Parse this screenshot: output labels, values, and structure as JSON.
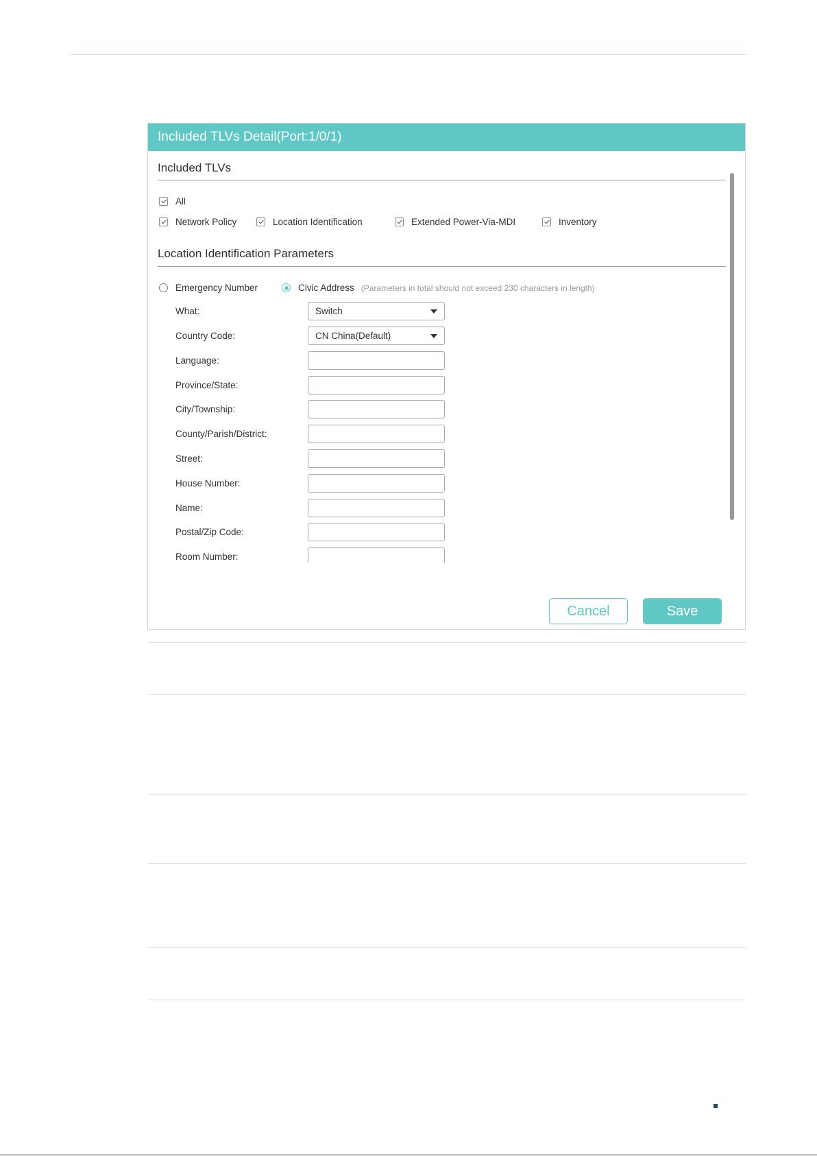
{
  "dialog": {
    "title": "Included TLVs Detail(Port:1/0/1)",
    "included_tlvs": {
      "heading": "Included TLVs",
      "all": {
        "label": "All",
        "checked": true
      },
      "options": [
        {
          "label": "Network Policy",
          "checked": true
        },
        {
          "label": "Location Identification",
          "checked": true
        },
        {
          "label": "Extended Power-Via-MDI",
          "checked": true
        },
        {
          "label": "Inventory",
          "checked": true
        }
      ]
    },
    "location": {
      "heading": "Location Identification Parameters",
      "emergency_label": "Emergency Number",
      "civic_label": "Civic Address",
      "civic_note": "(Parameters in total should not exceed 230 characters in length)",
      "selected": "Civic Address"
    },
    "fields": {
      "what": {
        "label": "What:",
        "value": "Switch"
      },
      "country_code": {
        "label": "Country Code:",
        "value": "CN China(Default)"
      },
      "language": {
        "label": "Language:",
        "value": ""
      },
      "province": {
        "label": "Province/State:",
        "value": ""
      },
      "city": {
        "label": "City/Township:",
        "value": ""
      },
      "county": {
        "label": "County/Parish/District:",
        "value": ""
      },
      "street": {
        "label": "Street:",
        "value": ""
      },
      "house_number": {
        "label": "House Number:",
        "value": ""
      },
      "name": {
        "label": "Name:",
        "value": ""
      },
      "postal": {
        "label": "Postal/Zip Code:",
        "value": ""
      },
      "room_number": {
        "label": "Room Number:",
        "value": ""
      }
    },
    "buttons": {
      "cancel": "Cancel",
      "save": "Save"
    }
  },
  "colors": {
    "accent": "#5fc8c5",
    "text": "#333333",
    "note": "#999999"
  },
  "icons": [
    "checkbox-checked-icon",
    "radio-icon",
    "caret-down-icon",
    "scrollbar-thumb"
  ]
}
